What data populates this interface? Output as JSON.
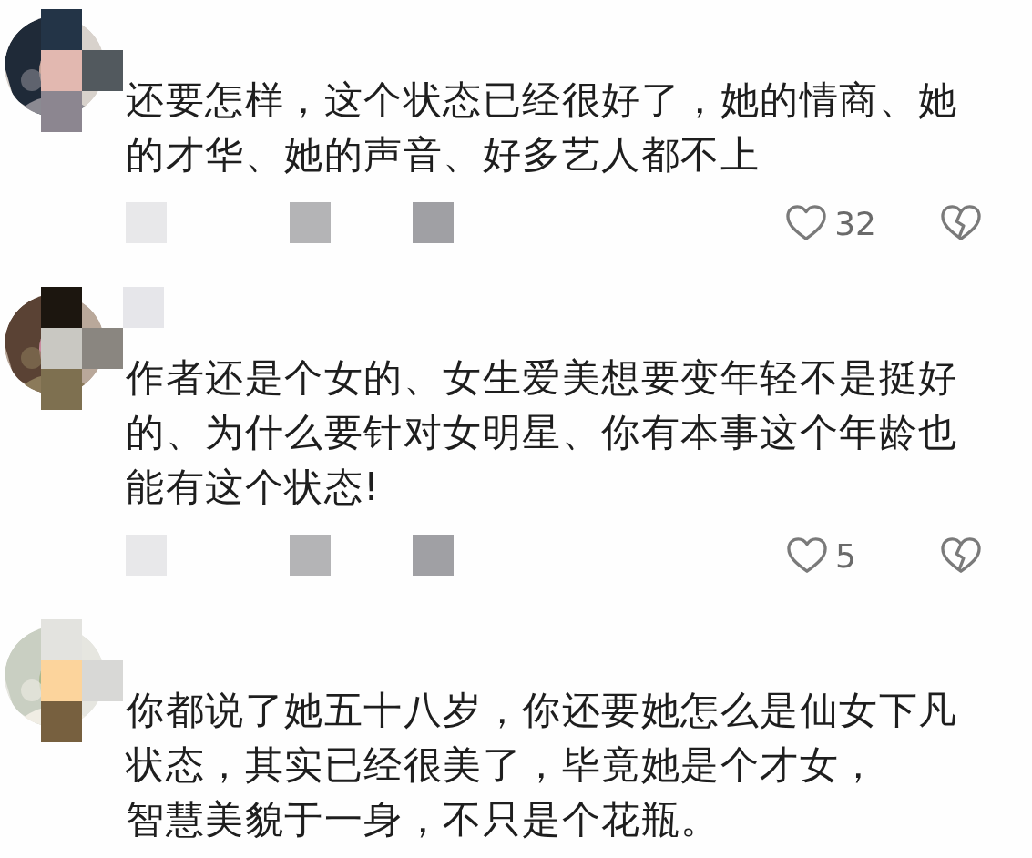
{
  "comments": [
    {
      "avatar": {
        "kind": "picture"
      },
      "paragraphs": [
        "还要怎样，这个状态已经很好了，她的情商、她的才华、她的声音、好多艺人都不上"
      ],
      "likes": "32"
    },
    {
      "avatar": {
        "kind": "picture"
      },
      "paragraphs": [
        "作者还是个女的、女生爱美想要变年轻不是挺好的、为什么要针对女明星、你有本事这个年龄也能有这个状态!"
      ],
      "likes": "5"
    },
    {
      "avatar": {
        "kind": "picture"
      },
      "paragraphs": [
        "你都说了她五十八岁，你还要她怎么是仙女下凡状态，其实已经很美了，毕竟她是个才女，",
        "智慧美貌于一身，不只是个花瓶。"
      ]
    }
  ]
}
